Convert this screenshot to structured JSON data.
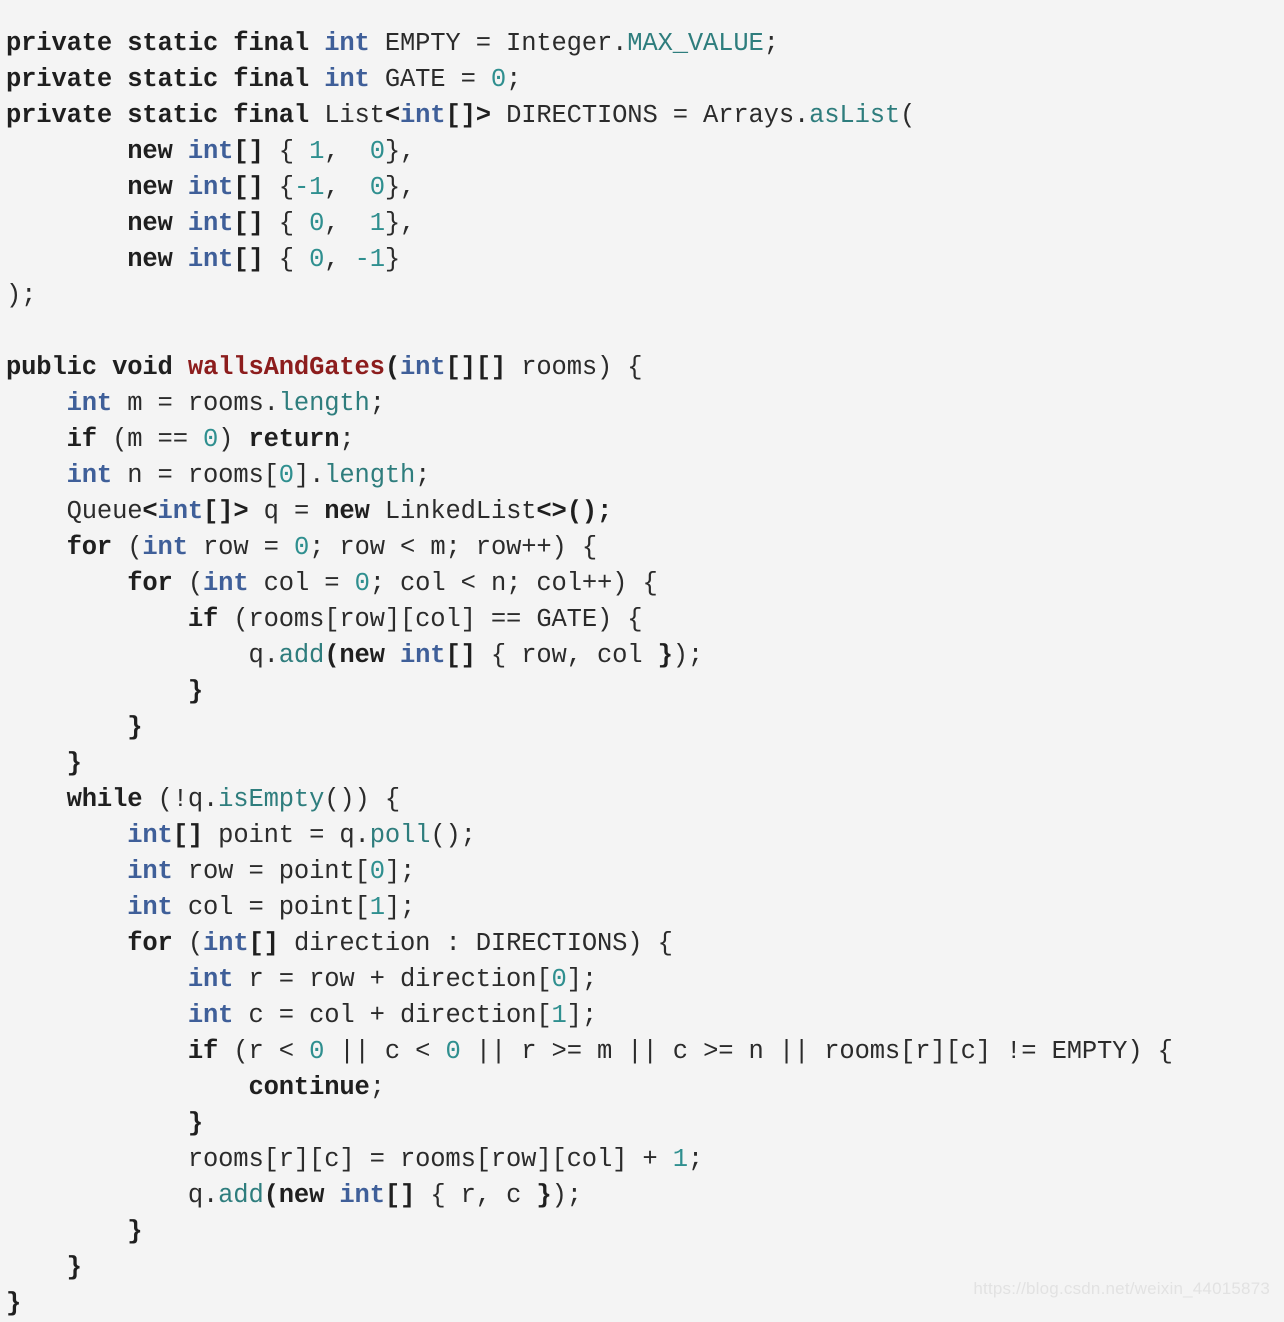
{
  "document": {
    "kind": "code-snippet",
    "language": "Java",
    "background_color": "#f4f4f4",
    "watermark": "https://blog.csdn.net/weixin_44015873"
  },
  "theme": {
    "keyword_color": "#1f1f1f",
    "type_color": "#3f5f99",
    "number_color": "#2f8f8f",
    "function_color": "#2e7d7d",
    "method_name_color": "#8c1d1d",
    "text_color": "#2b2b2b",
    "background_color": "#f4f4f4",
    "watermark_color": "#e2e2e2"
  },
  "code": {
    "plain_text": "private static final int EMPTY = Integer.MAX_VALUE;\nprivate static final int GATE = 0;\nprivate static final List<int[]> DIRECTIONS = Arrays.asList(\n        new int[] { 1,  0},\n        new int[] {-1,  0},\n        new int[] { 0,  1},\n        new int[] { 0, -1}\n);\n\npublic void wallsAndGates(int[][] rooms) {\n    int m = rooms.length;\n    if (m == 0) return;\n    int n = rooms[0].length;\n    Queue<int[]> q = new LinkedList<>();\n    for (int row = 0; row < m; row++) {\n        for (int col = 0; col < n; col++) {\n            if (rooms[row][col] == GATE) {\n                q.add(new int[] { row, col });\n            }\n        }\n    }\n    while (!q.isEmpty()) {\n        int[] point = q.poll();\n        int row = point[0];\n        int col = point[1];\n        for (int[] direction : DIRECTIONS) {\n            int r = row + direction[0];\n            int c = col + direction[1];\n            if (r < 0 || c < 0 || r >= m || c >= n || rooms[r][c] != EMPTY) {\n                continue;\n            }\n            rooms[r][c] = rooms[row][col] + 1;\n            q.add(new int[] { r, c });\n        }\n    }\n}",
    "lines": [
      [
        {
          "t": "private static final ",
          "c": "t-kw"
        },
        {
          "t": "int",
          "c": "t-type"
        },
        {
          "t": " EMPTY = Integer.",
          "c": "t-pun"
        },
        {
          "t": "MAX_VALUE",
          "c": "t-fn"
        },
        {
          "t": ";",
          "c": "t-pun"
        }
      ],
      [
        {
          "t": "private static final ",
          "c": "t-kw"
        },
        {
          "t": "int",
          "c": "t-type"
        },
        {
          "t": " GATE = ",
          "c": "t-pun"
        },
        {
          "t": "0",
          "c": "t-num"
        },
        {
          "t": ";",
          "c": "t-pun"
        }
      ],
      [
        {
          "t": "private static final ",
          "c": "t-kw"
        },
        {
          "t": "List",
          "c": "t-cls"
        },
        {
          "t": "<",
          "c": "t-punb"
        },
        {
          "t": "int",
          "c": "t-type"
        },
        {
          "t": "[]>",
          "c": "t-punb"
        },
        {
          "t": " DIRECTIONS = Arrays.",
          "c": "t-pun"
        },
        {
          "t": "asList",
          "c": "t-fn"
        },
        {
          "t": "(",
          "c": "t-pun"
        }
      ],
      [
        {
          "t": "        ",
          "c": "t-pun"
        },
        {
          "t": "new",
          "c": "t-kw"
        },
        {
          "t": " ",
          "c": "t-pun"
        },
        {
          "t": "int",
          "c": "t-type"
        },
        {
          "t": "[]",
          "c": "t-punb"
        },
        {
          "t": " { ",
          "c": "t-pun"
        },
        {
          "t": "1",
          "c": "t-num"
        },
        {
          "t": ",  ",
          "c": "t-pun"
        },
        {
          "t": "0",
          "c": "t-num"
        },
        {
          "t": "},",
          "c": "t-pun"
        }
      ],
      [
        {
          "t": "        ",
          "c": "t-pun"
        },
        {
          "t": "new",
          "c": "t-kw"
        },
        {
          "t": " ",
          "c": "t-pun"
        },
        {
          "t": "int",
          "c": "t-type"
        },
        {
          "t": "[]",
          "c": "t-punb"
        },
        {
          "t": " {",
          "c": "t-pun"
        },
        {
          "t": "-1",
          "c": "t-num"
        },
        {
          "t": ",  ",
          "c": "t-pun"
        },
        {
          "t": "0",
          "c": "t-num"
        },
        {
          "t": "},",
          "c": "t-pun"
        }
      ],
      [
        {
          "t": "        ",
          "c": "t-pun"
        },
        {
          "t": "new",
          "c": "t-kw"
        },
        {
          "t": " ",
          "c": "t-pun"
        },
        {
          "t": "int",
          "c": "t-type"
        },
        {
          "t": "[]",
          "c": "t-punb"
        },
        {
          "t": " { ",
          "c": "t-pun"
        },
        {
          "t": "0",
          "c": "t-num"
        },
        {
          "t": ",  ",
          "c": "t-pun"
        },
        {
          "t": "1",
          "c": "t-num"
        },
        {
          "t": "},",
          "c": "t-pun"
        }
      ],
      [
        {
          "t": "        ",
          "c": "t-pun"
        },
        {
          "t": "new",
          "c": "t-kw"
        },
        {
          "t": " ",
          "c": "t-pun"
        },
        {
          "t": "int",
          "c": "t-type"
        },
        {
          "t": "[]",
          "c": "t-punb"
        },
        {
          "t": " { ",
          "c": "t-pun"
        },
        {
          "t": "0",
          "c": "t-num"
        },
        {
          "t": ", ",
          "c": "t-pun"
        },
        {
          "t": "-1",
          "c": "t-num"
        },
        {
          "t": "}",
          "c": "t-pun"
        }
      ],
      [
        {
          "t": ");",
          "c": "t-pun"
        }
      ],
      [],
      [
        {
          "t": "public void ",
          "c": "t-kw"
        },
        {
          "t": "wallsAndGates",
          "c": "t-name"
        },
        {
          "t": "(",
          "c": "t-punb"
        },
        {
          "t": "int",
          "c": "t-type"
        },
        {
          "t": "[][]",
          "c": "t-punb"
        },
        {
          "t": " rooms) {",
          "c": "t-pun"
        }
      ],
      [
        {
          "t": "    ",
          "c": "t-pun"
        },
        {
          "t": "int",
          "c": "t-type"
        },
        {
          "t": " m = rooms.",
          "c": "t-pun"
        },
        {
          "t": "length",
          "c": "t-fn"
        },
        {
          "t": ";",
          "c": "t-pun"
        }
      ],
      [
        {
          "t": "    ",
          "c": "t-pun"
        },
        {
          "t": "if",
          "c": "t-kw"
        },
        {
          "t": " (m == ",
          "c": "t-pun"
        },
        {
          "t": "0",
          "c": "t-num"
        },
        {
          "t": ") ",
          "c": "t-pun"
        },
        {
          "t": "return",
          "c": "t-kw"
        },
        {
          "t": ";",
          "c": "t-pun"
        }
      ],
      [
        {
          "t": "    ",
          "c": "t-pun"
        },
        {
          "t": "int",
          "c": "t-type"
        },
        {
          "t": " n = rooms[",
          "c": "t-pun"
        },
        {
          "t": "0",
          "c": "t-num"
        },
        {
          "t": "].",
          "c": "t-pun"
        },
        {
          "t": "length",
          "c": "t-fn"
        },
        {
          "t": ";",
          "c": "t-pun"
        }
      ],
      [
        {
          "t": "    ",
          "c": "t-pun"
        },
        {
          "t": "Queue",
          "c": "t-cls"
        },
        {
          "t": "<",
          "c": "t-punb"
        },
        {
          "t": "int",
          "c": "t-type"
        },
        {
          "t": "[]>",
          "c": "t-punb"
        },
        {
          "t": " q = ",
          "c": "t-pun"
        },
        {
          "t": "new",
          "c": "t-kw"
        },
        {
          "t": " LinkedList",
          "c": "t-cls"
        },
        {
          "t": "<>();",
          "c": "t-punb"
        }
      ],
      [
        {
          "t": "    ",
          "c": "t-pun"
        },
        {
          "t": "for",
          "c": "t-kw"
        },
        {
          "t": " (",
          "c": "t-pun"
        },
        {
          "t": "int",
          "c": "t-type"
        },
        {
          "t": " row = ",
          "c": "t-pun"
        },
        {
          "t": "0",
          "c": "t-num"
        },
        {
          "t": "; row < m; row++) {",
          "c": "t-pun"
        }
      ],
      [
        {
          "t": "        ",
          "c": "t-pun"
        },
        {
          "t": "for",
          "c": "t-kw"
        },
        {
          "t": " (",
          "c": "t-pun"
        },
        {
          "t": "int",
          "c": "t-type"
        },
        {
          "t": " col = ",
          "c": "t-pun"
        },
        {
          "t": "0",
          "c": "t-num"
        },
        {
          "t": "; col < n; col++) {",
          "c": "t-pun"
        }
      ],
      [
        {
          "t": "            ",
          "c": "t-pun"
        },
        {
          "t": "if",
          "c": "t-kw"
        },
        {
          "t": " (rooms[row][col] == GATE) {",
          "c": "t-pun"
        }
      ],
      [
        {
          "t": "                q.",
          "c": "t-pun"
        },
        {
          "t": "add",
          "c": "t-fn"
        },
        {
          "t": "(",
          "c": "t-punb"
        },
        {
          "t": "new",
          "c": "t-kw"
        },
        {
          "t": " ",
          "c": "t-pun"
        },
        {
          "t": "int",
          "c": "t-type"
        },
        {
          "t": "[]",
          "c": "t-punb"
        },
        {
          "t": " { row, col ",
          "c": "t-pun"
        },
        {
          "t": "}",
          "c": "t-punb"
        },
        {
          "t": ");",
          "c": "t-pun"
        }
      ],
      [
        {
          "t": "            ",
          "c": "t-pun"
        },
        {
          "t": "}",
          "c": "t-punb"
        }
      ],
      [
        {
          "t": "        ",
          "c": "t-pun"
        },
        {
          "t": "}",
          "c": "t-punb"
        }
      ],
      [
        {
          "t": "    ",
          "c": "t-pun"
        },
        {
          "t": "}",
          "c": "t-punb"
        }
      ],
      [
        {
          "t": "    ",
          "c": "t-pun"
        },
        {
          "t": "while",
          "c": "t-kw"
        },
        {
          "t": " (!q.",
          "c": "t-pun"
        },
        {
          "t": "isEmpty",
          "c": "t-fn"
        },
        {
          "t": "()) {",
          "c": "t-pun"
        }
      ],
      [
        {
          "t": "        ",
          "c": "t-pun"
        },
        {
          "t": "int",
          "c": "t-type"
        },
        {
          "t": "[]",
          "c": "t-punb"
        },
        {
          "t": " point = q.",
          "c": "t-pun"
        },
        {
          "t": "poll",
          "c": "t-fn"
        },
        {
          "t": "();",
          "c": "t-pun"
        }
      ],
      [
        {
          "t": "        ",
          "c": "t-pun"
        },
        {
          "t": "int",
          "c": "t-type"
        },
        {
          "t": " row = point[",
          "c": "t-pun"
        },
        {
          "t": "0",
          "c": "t-num"
        },
        {
          "t": "];",
          "c": "t-pun"
        }
      ],
      [
        {
          "t": "        ",
          "c": "t-pun"
        },
        {
          "t": "int",
          "c": "t-type"
        },
        {
          "t": " col = point[",
          "c": "t-pun"
        },
        {
          "t": "1",
          "c": "t-num"
        },
        {
          "t": "];",
          "c": "t-pun"
        }
      ],
      [
        {
          "t": "        ",
          "c": "t-pun"
        },
        {
          "t": "for",
          "c": "t-kw"
        },
        {
          "t": " (",
          "c": "t-pun"
        },
        {
          "t": "int",
          "c": "t-type"
        },
        {
          "t": "[]",
          "c": "t-punb"
        },
        {
          "t": " direction : DIRECTIONS) {",
          "c": "t-pun"
        }
      ],
      [
        {
          "t": "            ",
          "c": "t-pun"
        },
        {
          "t": "int",
          "c": "t-type"
        },
        {
          "t": " r = row + direction[",
          "c": "t-pun"
        },
        {
          "t": "0",
          "c": "t-num"
        },
        {
          "t": "];",
          "c": "t-pun"
        }
      ],
      [
        {
          "t": "            ",
          "c": "t-pun"
        },
        {
          "t": "int",
          "c": "t-type"
        },
        {
          "t": " c = col + direction[",
          "c": "t-pun"
        },
        {
          "t": "1",
          "c": "t-num"
        },
        {
          "t": "];",
          "c": "t-pun"
        }
      ],
      [
        {
          "t": "            ",
          "c": "t-pun"
        },
        {
          "t": "if",
          "c": "t-kw"
        },
        {
          "t": " (r < ",
          "c": "t-pun"
        },
        {
          "t": "0",
          "c": "t-num"
        },
        {
          "t": " || c < ",
          "c": "t-pun"
        },
        {
          "t": "0",
          "c": "t-num"
        },
        {
          "t": " || r >= m || c >= n || rooms[r][c] != EMPTY) {",
          "c": "t-pun"
        }
      ],
      [
        {
          "t": "                ",
          "c": "t-pun"
        },
        {
          "t": "continue",
          "c": "t-kw"
        },
        {
          "t": ";",
          "c": "t-pun"
        }
      ],
      [
        {
          "t": "            ",
          "c": "t-pun"
        },
        {
          "t": "}",
          "c": "t-punb"
        }
      ],
      [
        {
          "t": "            rooms[r][c] = rooms[row][col] + ",
          "c": "t-pun"
        },
        {
          "t": "1",
          "c": "t-num"
        },
        {
          "t": ";",
          "c": "t-pun"
        }
      ],
      [
        {
          "t": "            q.",
          "c": "t-pun"
        },
        {
          "t": "add",
          "c": "t-fn"
        },
        {
          "t": "(",
          "c": "t-punb"
        },
        {
          "t": "new",
          "c": "t-kw"
        },
        {
          "t": " ",
          "c": "t-pun"
        },
        {
          "t": "int",
          "c": "t-type"
        },
        {
          "t": "[]",
          "c": "t-punb"
        },
        {
          "t": " { r, c ",
          "c": "t-pun"
        },
        {
          "t": "}",
          "c": "t-punb"
        },
        {
          "t": ");",
          "c": "t-pun"
        }
      ],
      [
        {
          "t": "        ",
          "c": "t-pun"
        },
        {
          "t": "}",
          "c": "t-punb"
        }
      ],
      [
        {
          "t": "    ",
          "c": "t-pun"
        },
        {
          "t": "}",
          "c": "t-punb"
        }
      ],
      [
        {
          "t": "}",
          "c": "t-punb"
        }
      ]
    ]
  }
}
